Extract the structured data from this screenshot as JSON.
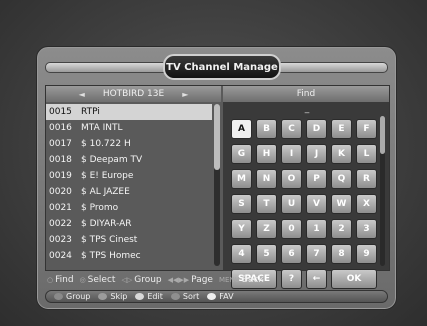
{
  "title": "TV Channel Manage",
  "satellite": {
    "name": "HOTBIRD 13E",
    "left_arrow": "◄",
    "right_arrow": "►"
  },
  "channels": [
    {
      "num": "0015",
      "name": "RTPi"
    },
    {
      "num": "0016",
      "name": "MTA INTL"
    },
    {
      "num": "0017",
      "name": "$ 10.722 H"
    },
    {
      "num": "0018",
      "name": "$ Deepam TV"
    },
    {
      "num": "0019",
      "name": "$ E! Europe"
    },
    {
      "num": "0020",
      "name": "$ AL JAZEE"
    },
    {
      "num": "0021",
      "name": "$ Promo"
    },
    {
      "num": "0022",
      "name": "$ DIYAR-AR"
    },
    {
      "num": "0023",
      "name": "$ TPS Cinest"
    },
    {
      "num": "0024",
      "name": "$ TPS Homec"
    }
  ],
  "selected_channel_index": 0,
  "find": {
    "label": "Find",
    "input_value": "_"
  },
  "keyboard": {
    "keys": [
      "A",
      "B",
      "C",
      "D",
      "E",
      "F",
      "G",
      "H",
      "I",
      "J",
      "K",
      "L",
      "M",
      "N",
      "O",
      "P",
      "Q",
      "R",
      "S",
      "T",
      "U",
      "V",
      "W",
      "X",
      "Y",
      "Z",
      "0",
      "1",
      "2",
      "3",
      "4",
      "5",
      "6",
      "7",
      "8",
      "9"
    ],
    "space": "SPACE",
    "question": "?",
    "backspace": "←",
    "ok": "OK",
    "active_key": "A"
  },
  "help": [
    {
      "key": "○",
      "label": "Find"
    },
    {
      "key": "◎",
      "label": "Select"
    },
    {
      "key": "◁▷",
      "label": "Group"
    },
    {
      "key": "◀◀▶▶",
      "label": "Page"
    },
    {
      "key": "MENU",
      "label": "Back"
    }
  ],
  "color_buttons": [
    {
      "label": "Group",
      "color": "#8a8a8a"
    },
    {
      "label": "Skip",
      "color": "#9c9c9c"
    },
    {
      "label": "Edit",
      "color": "#d8d8d8"
    },
    {
      "label": "Sort",
      "color": "#8f8f8f"
    },
    {
      "label": "FAV",
      "color": "#eeeeee"
    }
  ]
}
